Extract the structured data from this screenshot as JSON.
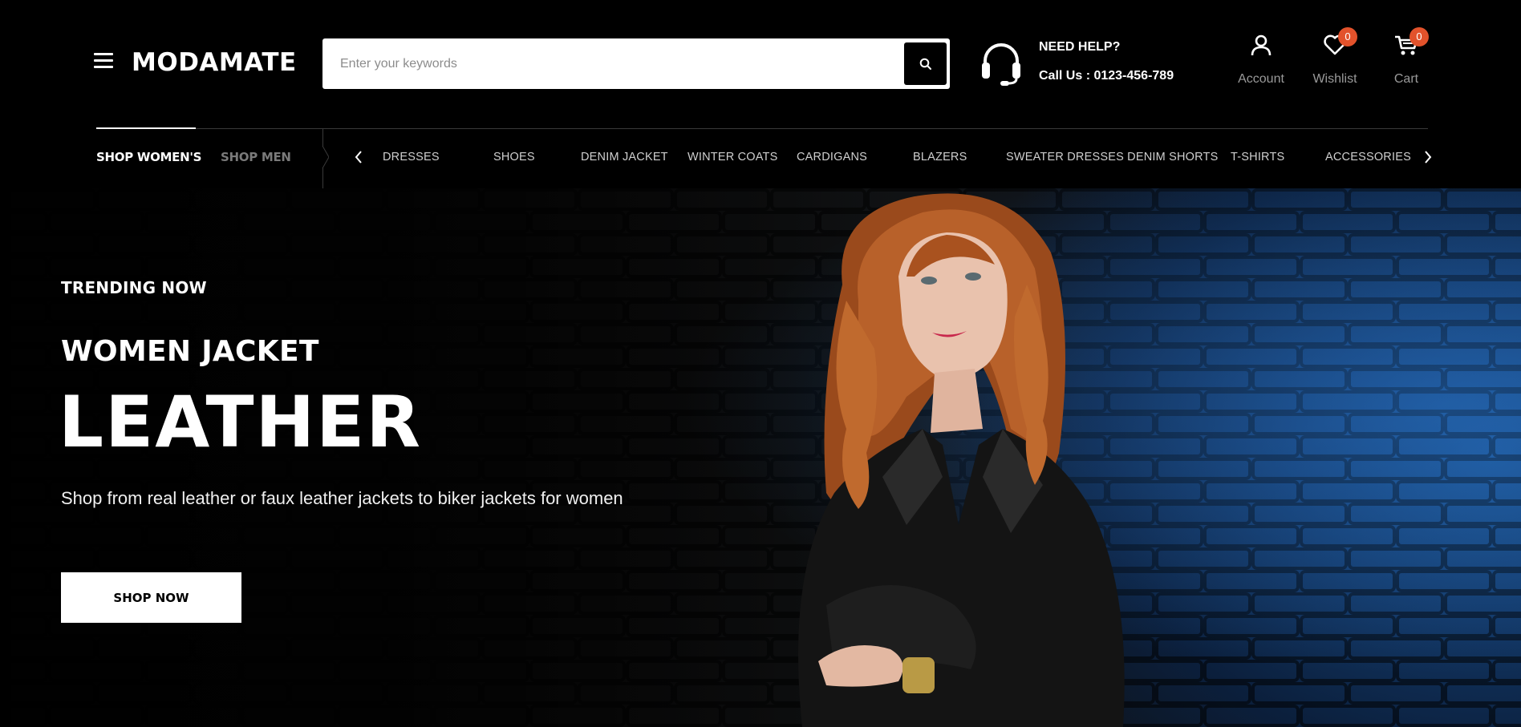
{
  "header": {
    "logo": "MODAMATE",
    "menu_icon": "hamburger-menu-icon",
    "search": {
      "placeholder": "Enter your keywords",
      "value": "",
      "button_icon": "search-icon"
    },
    "help": {
      "icon": "headset-icon",
      "title": "NEED HELP?",
      "phone": "Call Us : 0123-456-789"
    },
    "account": {
      "icon": "user-icon",
      "label": "Account"
    },
    "wishlist": {
      "icon": "heart-icon",
      "label": "Wishlist",
      "count": "0"
    },
    "cart": {
      "icon": "cart-icon",
      "label": "Cart",
      "count": "0"
    },
    "badge_color": "#e2522b"
  },
  "nav": {
    "tabs": [
      {
        "label": "SHOP WOMEN'S",
        "active": true
      },
      {
        "label": "SHOP MEN'",
        "active": false
      }
    ],
    "categories": [
      "DRESSES",
      "SHOES",
      "DENIM JACKET",
      "WINTER COATS",
      "CARDIGANS",
      "BLAZERS",
      "SWEATER DRESSES DENIM SHORTS",
      "T-SHIRTS",
      "ACCESSORIES"
    ],
    "prev_icon": "chevron-left-icon",
    "next_icon": "chevron-right-icon"
  },
  "hero": {
    "eyebrow": "TRENDING NOW",
    "subtitle": "WOMEN JACKET",
    "headline": "LEATHER",
    "description": "Shop from real leather or faux leather jackets to biker jackets for women",
    "cta": "SHOP NOW"
  }
}
